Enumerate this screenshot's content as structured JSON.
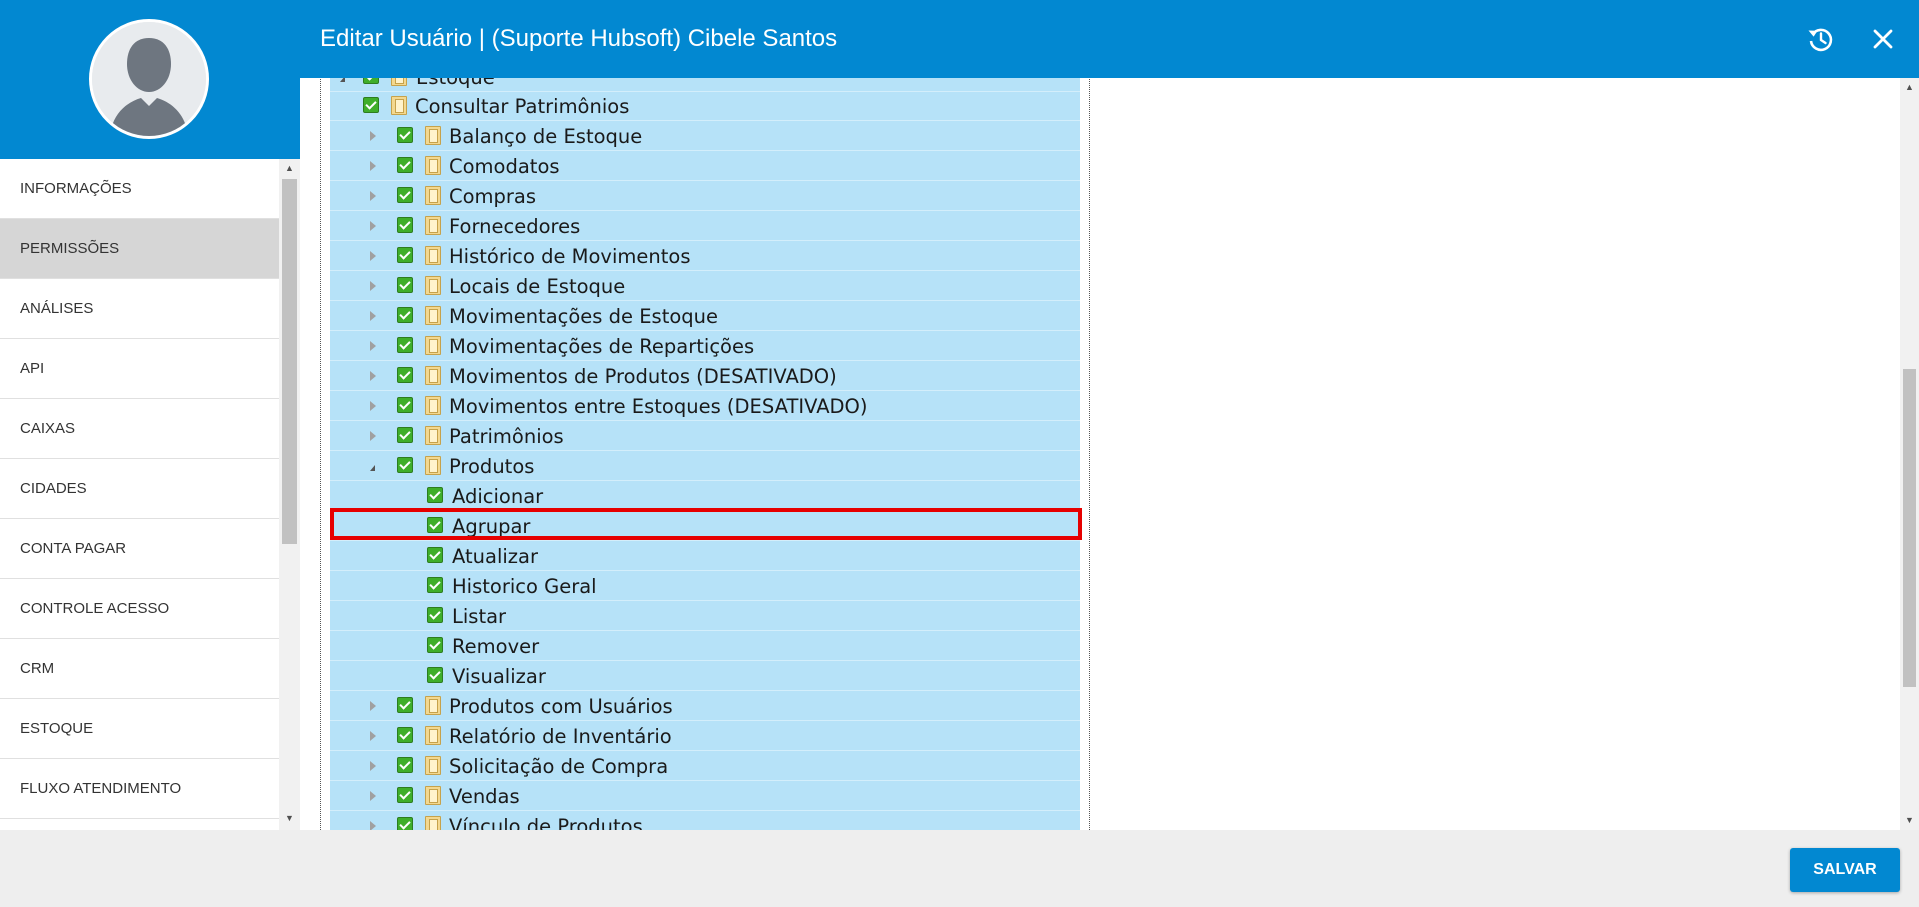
{
  "header": {
    "title": "Editar Usuário | (Suporte Hubsoft) Cibele Santos",
    "history_icon": "history-icon",
    "close_icon": "close-icon"
  },
  "colors": {
    "primary": "#0288d1",
    "tree_background": "#b6e2f8",
    "check_green": "#3fae2a",
    "highlight": "#e60000"
  },
  "sidebar": {
    "items": [
      {
        "label": "INFORMAÇÕES",
        "active": false
      },
      {
        "label": "PERMISSÕES",
        "active": true
      },
      {
        "label": "ANÁLISES",
        "active": false
      },
      {
        "label": "API",
        "active": false
      },
      {
        "label": "CAIXAS",
        "active": false
      },
      {
        "label": "CIDADES",
        "active": false
      },
      {
        "label": "CONTA PAGAR",
        "active": false
      },
      {
        "label": "CONTROLE ACESSO",
        "active": false
      },
      {
        "label": "CRM",
        "active": false
      },
      {
        "label": "ESTOQUE",
        "active": false
      },
      {
        "label": "FLUXO ATENDIMENTO",
        "active": false
      }
    ]
  },
  "tree": {
    "parent": "Estoque",
    "nodes": [
      {
        "label": "Consultar Patrimônios",
        "expander": "none",
        "checked": true,
        "folder": true
      },
      {
        "label": "Balanço de Estoque",
        "expander": "collapsed",
        "checked": true,
        "folder": true
      },
      {
        "label": "Comodatos",
        "expander": "collapsed",
        "checked": true,
        "folder": true
      },
      {
        "label": "Compras",
        "expander": "collapsed",
        "checked": true,
        "folder": true
      },
      {
        "label": "Fornecedores",
        "expander": "collapsed",
        "checked": true,
        "folder": true
      },
      {
        "label": "Histórico de Movimentos",
        "expander": "collapsed",
        "checked": true,
        "folder": true
      },
      {
        "label": "Locais de Estoque",
        "expander": "collapsed",
        "checked": true,
        "folder": true
      },
      {
        "label": "Movimentações de Estoque",
        "expander": "collapsed",
        "checked": true,
        "folder": true
      },
      {
        "label": "Movimentações de Repartições",
        "expander": "collapsed",
        "checked": true,
        "folder": true
      },
      {
        "label": "Movimentos de Produtos (DESATIVADO)",
        "expander": "collapsed",
        "checked": true,
        "folder": true
      },
      {
        "label": "Movimentos entre Estoques (DESATIVADO)",
        "expander": "collapsed",
        "checked": true,
        "folder": true
      },
      {
        "label": "Patrimônios",
        "expander": "collapsed",
        "checked": true,
        "folder": true
      },
      {
        "label": "Produtos",
        "expander": "expanded",
        "checked": true,
        "folder": true
      },
      {
        "label": "Adicionar",
        "expander": "none",
        "checked": true,
        "folder": false
      },
      {
        "label": "Agrupar",
        "expander": "none",
        "checked": true,
        "folder": false,
        "highlighted": true
      },
      {
        "label": "Atualizar",
        "expander": "none",
        "checked": true,
        "folder": false
      },
      {
        "label": "Historico Geral",
        "expander": "none",
        "checked": true,
        "folder": false
      },
      {
        "label": "Listar",
        "expander": "none",
        "checked": true,
        "folder": false
      },
      {
        "label": "Remover",
        "expander": "none",
        "checked": true,
        "folder": false
      },
      {
        "label": "Visualizar",
        "expander": "none",
        "checked": true,
        "folder": false
      },
      {
        "label": "Produtos com Usuários",
        "expander": "collapsed",
        "checked": true,
        "folder": true
      },
      {
        "label": "Relatório de Inventário",
        "expander": "collapsed",
        "checked": true,
        "folder": true
      },
      {
        "label": "Solicitação de Compra",
        "expander": "collapsed",
        "checked": true,
        "folder": true
      },
      {
        "label": "Vendas",
        "expander": "collapsed",
        "checked": true,
        "folder": true
      },
      {
        "label": "Vínculo de Produtos",
        "expander": "collapsed",
        "checked": true,
        "folder": true
      }
    ]
  },
  "footer": {
    "save_label": "SALVAR"
  }
}
